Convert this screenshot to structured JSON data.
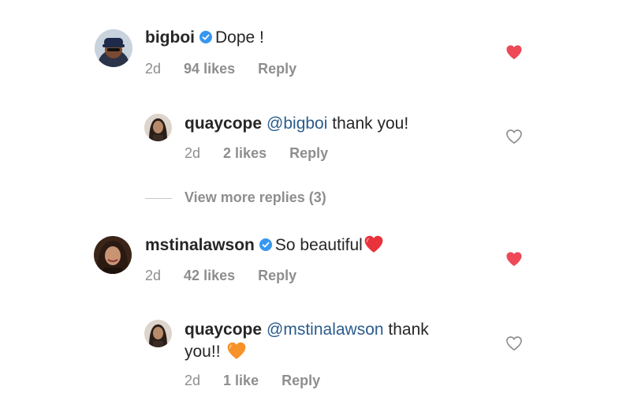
{
  "comments": [
    {
      "username": "bigboi",
      "verified": true,
      "text": "Dope !",
      "time": "2d",
      "likes": "94 likes",
      "reply": "Reply",
      "liked": true
    },
    {
      "username": "mstinalawson",
      "verified": true,
      "text": "So beautiful",
      "emoji": "❤️",
      "time": "2d",
      "likes": "42 likes",
      "reply": "Reply",
      "liked": true
    }
  ],
  "replies": [
    {
      "username": "quaycope",
      "mention": "@bigboi",
      "text": "thank you!",
      "time": "2d",
      "likes": "2 likes",
      "reply": "Reply",
      "liked": false
    },
    {
      "username": "quaycope",
      "mention": "@mstinalawson",
      "text_line1": "thank",
      "text_line2": "you!!",
      "emoji": "🧡",
      "time": "2d",
      "likes": "1 like",
      "reply": "Reply",
      "liked": false
    }
  ],
  "view_more": {
    "label": "View more replies (3)"
  },
  "colors": {
    "heart_filled": "#ed4956",
    "heart_outline": "#8e8e8e",
    "verified": "#3897f0",
    "mention": "#2a5c8c",
    "meta": "#8e8e8e"
  },
  "icons": {
    "liked": "heart-filled-icon",
    "unliked": "heart-outline-icon",
    "verified": "verified-badge-icon"
  }
}
